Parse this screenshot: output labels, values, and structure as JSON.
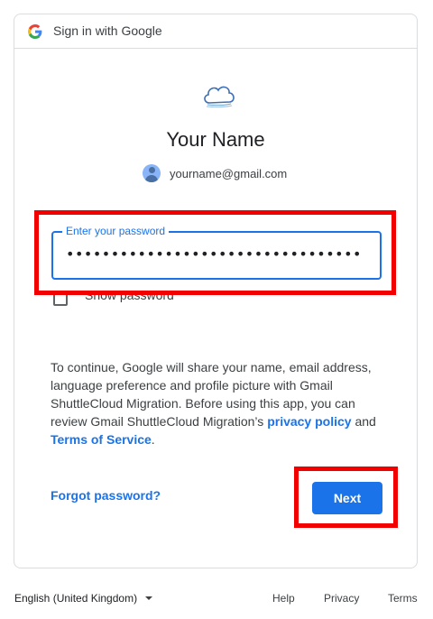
{
  "header": {
    "title": "Sign in with Google",
    "logo_icon": "google-g-icon"
  },
  "app": {
    "logo_icon": "cloud-icon"
  },
  "user": {
    "name": "Your Name",
    "email": "yourname@gmail.com",
    "avatar_icon": "avatar-icon"
  },
  "password": {
    "label": "Enter your password",
    "masked_value": "•••••••••••••••••••••••••••••••••"
  },
  "show_password": {
    "label": "Show password",
    "checked": false
  },
  "consent": {
    "line_text": "To continue, Google will share your name, email address, language preference and profile picture with Gmail ShuttleCloud Migration. Before using this app, you can review Gmail ShuttleCloud Migration’s ",
    "privacy_link": "privacy policy",
    "and": " and ",
    "terms_link": "Terms of Service",
    "end": "."
  },
  "actions": {
    "forgot_label": "Forgot password?",
    "next_label": "Next"
  },
  "footer": {
    "language": "English (United Kingdom)",
    "help": "Help",
    "privacy": "Privacy",
    "terms": "Terms"
  },
  "colors": {
    "accent": "#1a73e8",
    "highlight": "#f20000",
    "border": "#dadce0"
  }
}
